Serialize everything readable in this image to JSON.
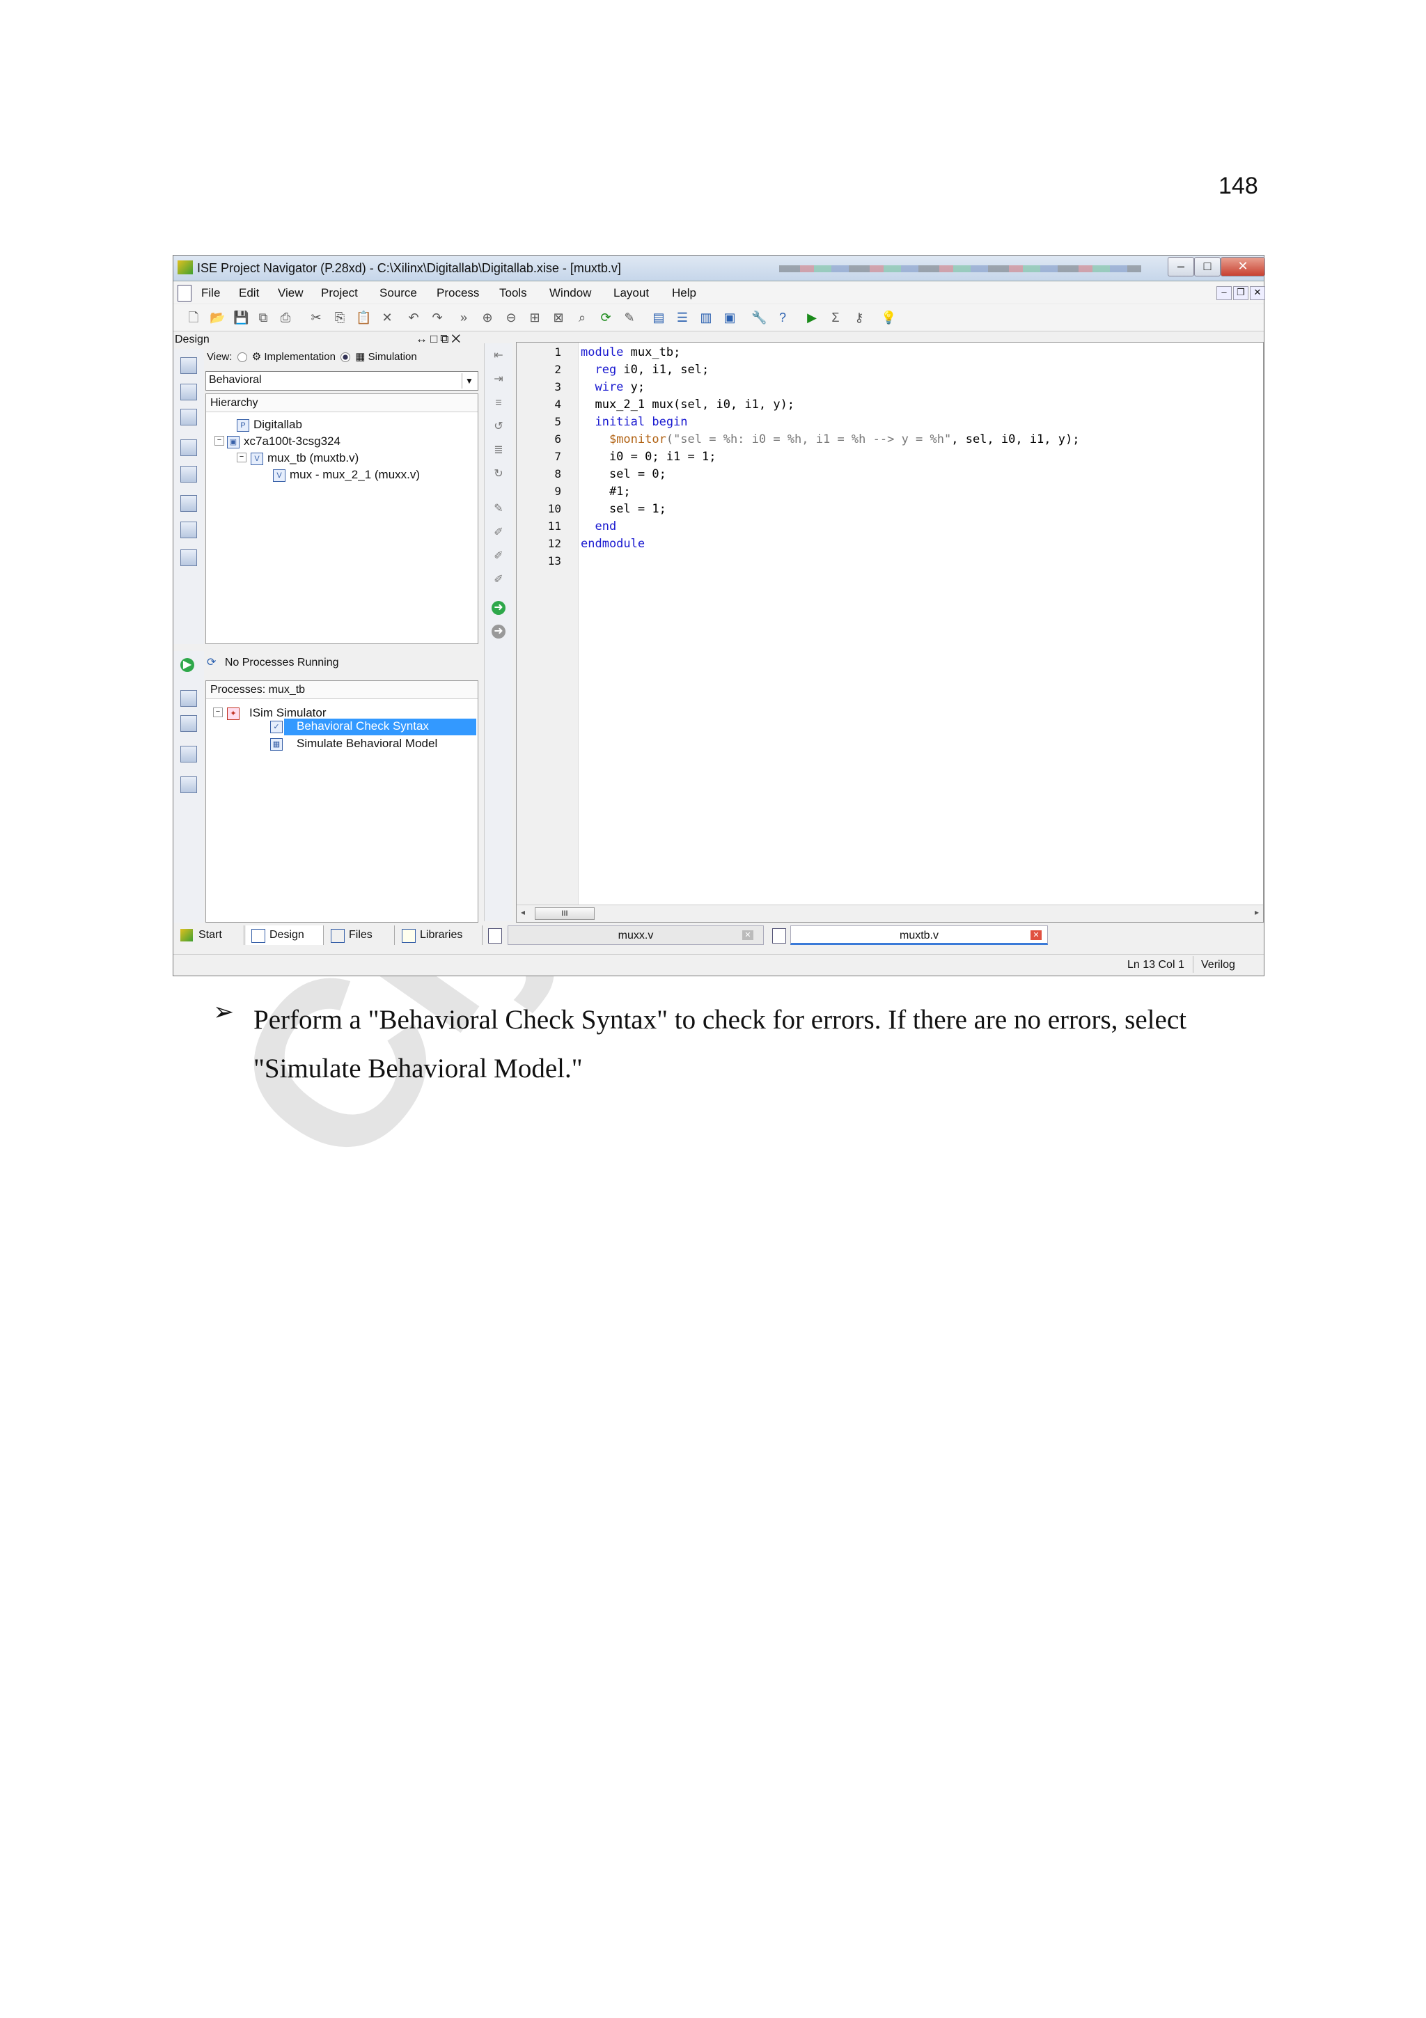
{
  "page_number": "148",
  "watermark": "Ciyamala",
  "window": {
    "title": "ISE Project Navigator (P.28xd) - C:\\Xilinx\\Digitallab\\Digitallab.xise - [muxtb.v]"
  },
  "menu": [
    "File",
    "Edit",
    "View",
    "Project",
    "Source",
    "Process",
    "Tools",
    "Window",
    "Layout",
    "Help"
  ],
  "design_panel": {
    "header": "Design",
    "view_label": "View:",
    "view_options": [
      "Implementation",
      "Simulation"
    ],
    "view_selected": "Simulation",
    "behavior_select": "Behavioral",
    "hierarchy_header": "Hierarchy",
    "tree": [
      {
        "label": "Digitallab",
        "icon": "project-icon"
      },
      {
        "label": "xc7a100t-3csg324",
        "icon": "chip-icon"
      },
      {
        "label": "mux_tb (muxtb.v)",
        "icon": "verilog-file-icon"
      },
      {
        "label": "mux - mux_2_1 (muxx.v)",
        "icon": "verilog-file-icon"
      }
    ]
  },
  "process_panel": {
    "status": "No Processes Running",
    "header": "Processes: mux_tb",
    "items": [
      {
        "label": "ISim Simulator",
        "icon": "simulator-icon"
      },
      {
        "label": "Behavioral Check Syntax",
        "icon": "check-syntax-icon",
        "selected": true
      },
      {
        "label": "Simulate Behavioral Model",
        "icon": "simulate-icon"
      }
    ]
  },
  "bottom_tabs": [
    "Start",
    "Design",
    "Files",
    "Libraries"
  ],
  "editor": {
    "line_numbers": [
      "1",
      "2",
      "3",
      "4",
      "5",
      "6",
      "7",
      "8",
      "9",
      "10",
      "11",
      "12",
      "13"
    ],
    "lines": [
      {
        "kw": "module",
        "rest": " mux_tb;"
      },
      {
        "kw": "  reg",
        "rest": " i0, i1, sel;"
      },
      {
        "kw": "  wire",
        "rest": " y;"
      },
      {
        "kw": "",
        "rest": "  mux_2_1 mux(sel, i0, i1, y);"
      },
      {
        "kw": "  initial begin",
        "rest": ""
      },
      {
        "sys": "    $monitor",
        "str": "(\"sel = %h: i0 = %h, i1 = %h --> y = %h\"",
        "rest": ", sel, i0, i1, y);"
      },
      {
        "kw": "",
        "rest": "    i0 = 0; i1 = 1;"
      },
      {
        "kw": "",
        "rest": "    sel = 0;"
      },
      {
        "kw": "",
        "rest": "    #1;"
      },
      {
        "kw": "",
        "rest": "    sel = 1;"
      },
      {
        "kw": "  end",
        "rest": ""
      },
      {
        "kw": "endmodule",
        "rest": ""
      },
      {
        "kw": "",
        "rest": ""
      }
    ],
    "tabs": [
      {
        "label": "muxx.v",
        "active": false
      },
      {
        "label": "muxtb.v",
        "active": true
      }
    ],
    "scroll_thumb": "III"
  },
  "status_bar": {
    "position": "Ln 13 Col 1",
    "language": "Verilog"
  },
  "instruction": {
    "bullet": "➢",
    "text": "Perform a \"Behavioral Check Syntax\" to check for errors. If there are no errors, select \"Simulate Behavioral Model.\""
  },
  "colors": {
    "selection": "#3399ff",
    "keyword": "#1a1ad0",
    "system_task": "#b06010",
    "close_button": "#c84030"
  }
}
